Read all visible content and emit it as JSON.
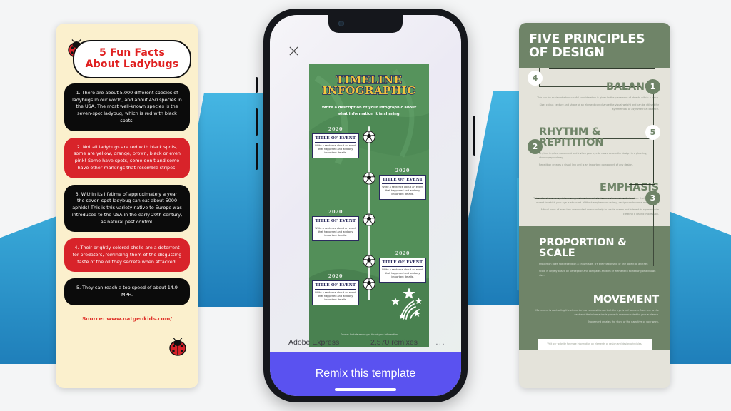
{
  "canvas": {
    "bg_color": "#f4f5f6",
    "accent_blue_light": "#45b6e3",
    "accent_blue_dark": "#1d7cb8"
  },
  "ladybug_infographic": {
    "panel_bg": "#fbf0cd",
    "title_line1": "5 Fun Facts",
    "title_line2": "About Ladybugs",
    "title_color": "#e02020",
    "facts": [
      {
        "text": "1. There are about 5,000 different species of ladybugs in our world, and about 450 species in the USA. The most well-known species is the seven-spot ladybug, which is red with black spots.",
        "style": "black"
      },
      {
        "text": "2. Not all ladybugs are red with black spots, some are yellow, orange, brown, black or even pink! Some have spots, some don't and some have other markings that resemble stripes.",
        "style": "red"
      },
      {
        "text": "3. Within its lifetime of approximately a year, the seven-spot ladybug can eat about 5000 aphids! This is this variety native to Europe was introduced to the USA in the early 20th century, as natural pest control.",
        "style": "black"
      },
      {
        "text": "4. Their brightly colored shells are a deterrent for predators, reminding them of the disgusting taste of the oil they secrete when attacked.",
        "style": "red"
      },
      {
        "text": "5. They can reach a top speed of about 14.9 MPH.",
        "style": "black"
      }
    ],
    "source": "Source: www.natgeokids.com/"
  },
  "phone": {
    "close_icon": "close-icon",
    "template": {
      "title_line1": "TIMELINE",
      "title_line2": "INFOGRAPHIC",
      "title_color": "#f2c53d",
      "title_outline": "#2b2b5e",
      "bg_color": "#4e8a55",
      "description": "Write a description of your infographic about what information it is sharing.",
      "events": [
        {
          "year": "2020",
          "title": "TITLE OF EVENT",
          "body": "Write a sentence about an event that happened and add any important details.",
          "side": "left"
        },
        {
          "year": "2020",
          "title": "TITLE OF EVENT",
          "body": "Write a sentence about an event that happened and add any important details.",
          "side": "right"
        },
        {
          "year": "2020",
          "title": "TITLE OF EVENT",
          "body": "Write a sentence about an event that happened and add any important details.",
          "side": "left"
        },
        {
          "year": "2020",
          "title": "TITLE OF EVENT",
          "body": "Write a sentence about an event that happened and add any important details.",
          "side": "right"
        },
        {
          "year": "2020",
          "title": "TITLE OF EVENT",
          "body": "Write a sentence about an event that happened and add any important details.",
          "side": "left"
        }
      ],
      "footer_note": "Source: Include where you found your information"
    },
    "meta": {
      "brand": "Adobe Express",
      "remix_count": "2,570 remixes",
      "more_icon": "..."
    },
    "cta_label": "Remix this template",
    "cta_color": "#5a52f0"
  },
  "design_infographic": {
    "panel_bg": "#e4e3da",
    "dark_bg": "#6f8468",
    "header_line1": "FIVE PRINCIPLES",
    "header_line2": "OF DESIGN",
    "sections": [
      {
        "number": "1",
        "title": "BALANCE",
        "paragraphs": [
          "This can be achieved when careful consideration is given to the placement of objects within a piece.",
          "Size, colour, texture and shape of an element can change the visual weight and can be utilised for symmetrical or asymmetrical balance."
        ],
        "theme": "light",
        "align": "right"
      },
      {
        "number": "2",
        "title": "RHYTHM & REPITITION",
        "paragraphs": [
          "Rhythm implies movement and invites your eye to move across the design in a pleasing, choreographed way.",
          "Repetition creates a visual link and is an important component of any design."
        ],
        "theme": "light",
        "align": "left"
      },
      {
        "number": "3",
        "title": "EMPHASIS",
        "paragraphs": [
          "This refers to a focal point and supportive elements that create the center of attention. It should be the accent to which your eye is attracted. Without emphasis or variety, design can become monotonous.",
          "A focal point of even two unexpected ones can help to create drama and interest in a piece while creating a lasting impression."
        ],
        "theme": "light",
        "align": "right"
      },
      {
        "number": "4",
        "title": "PROPORTION & SCALE",
        "paragraphs": [
          "Proportion does not depend on a known size. It's the relationship of one object to another.",
          "Scale is largely based on perception and compares an item or element to something of a known size."
        ],
        "theme": "dark",
        "align": "left"
      },
      {
        "number": "5",
        "title": "MOVEMENT",
        "paragraphs": [
          "Movement is controlling the elements in a composition so that the eye is led to move from one to the next and the information is properly communicated to your audience.",
          "Movement creates the story or the narrative of your work."
        ],
        "theme": "dark",
        "align": "right"
      }
    ],
    "footer": "Visit our website for more information on elements of design and design principles."
  }
}
